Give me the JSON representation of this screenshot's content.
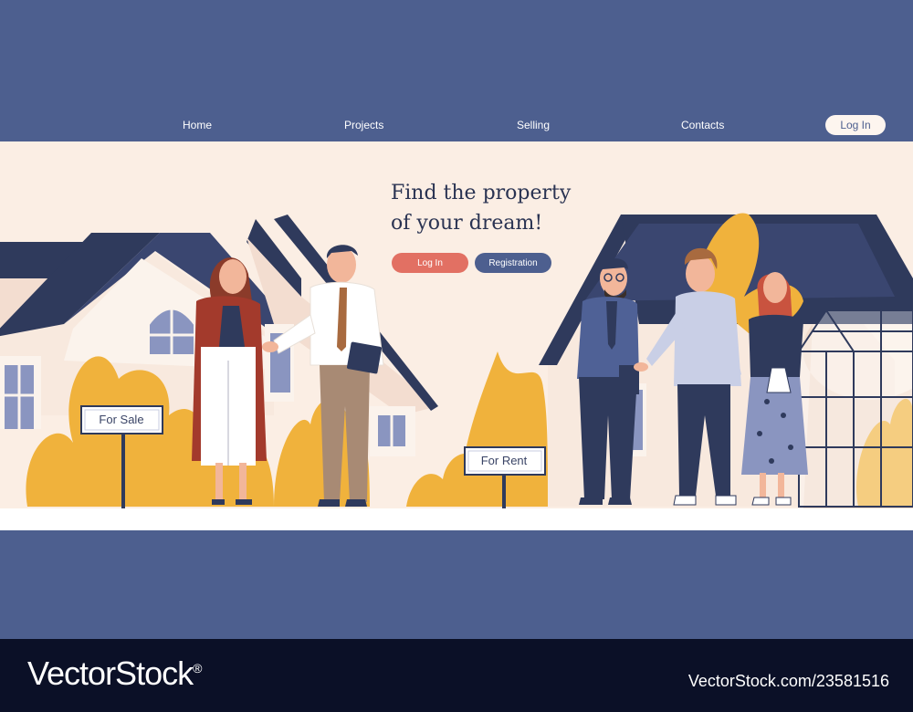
{
  "nav": {
    "items": [
      {
        "label": "Home"
      },
      {
        "label": "Projects"
      },
      {
        "label": "Selling"
      },
      {
        "label": "Contacts"
      }
    ],
    "login_label": "Log In"
  },
  "hero": {
    "headline_line1": "Find the property",
    "headline_line2": "of your dream!",
    "login_button": "Log In",
    "registration_button": "Registration"
  },
  "signs": {
    "for_sale": "For Sale",
    "for_rent": "For Rent"
  },
  "watermark": {
    "brand": "VectorStock",
    "registered_mark": "®",
    "image_id": "VectorStock.com/23581516"
  },
  "colors": {
    "header_bg": "#4d5f8f",
    "hero_bg": "#fbeee4",
    "accent_coral": "#e27063",
    "accent_navy": "#4d5f8f",
    "foliage": "#f0b23c",
    "roof": "#2f3a5c",
    "footer_bg": "#0b1027"
  }
}
